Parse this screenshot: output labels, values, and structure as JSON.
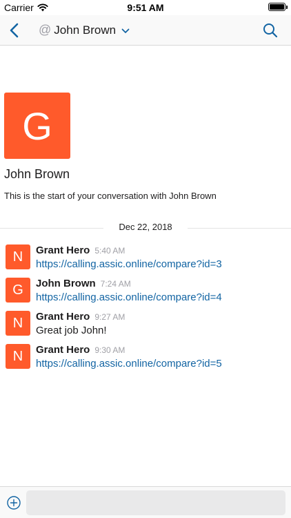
{
  "status_bar": {
    "carrier": "Carrier",
    "time": "9:51 AM",
    "battery_level": 1.0
  },
  "nav": {
    "back_icon": "chevron-left-icon",
    "at_symbol": "@",
    "title": "John Brown",
    "dropdown_icon": "chevron-down-icon",
    "search_icon": "search-icon"
  },
  "intro": {
    "avatar_letter": "G",
    "name": "John Brown",
    "text": "This is the start of your conversation with John Brown"
  },
  "date_divider": "Dec 22, 2018",
  "messages": [
    {
      "avatar": "N",
      "sender": "Grant Hero",
      "time": "5:40 AM",
      "text": "https://calling.assic.online/compare?id=3"
    },
    {
      "avatar": "G",
      "sender": "John Brown",
      "time": "7:24 AM",
      "text": "https://calling.assic.online/compare?id=4"
    },
    {
      "avatar": "N",
      "sender": "Grant Hero",
      "time": "9:27 AM",
      "text": "Great job John!"
    },
    {
      "avatar": "N",
      "sender": "Grant Hero",
      "time": "9:30 AM",
      "text": "https://calling.assic.online/compare?id=5"
    }
  ],
  "composer": {
    "add_icon": "plus-circle-icon",
    "placeholder": ""
  },
  "colors": {
    "accent": "#1264a3",
    "avatar": "#ff5a2b"
  }
}
